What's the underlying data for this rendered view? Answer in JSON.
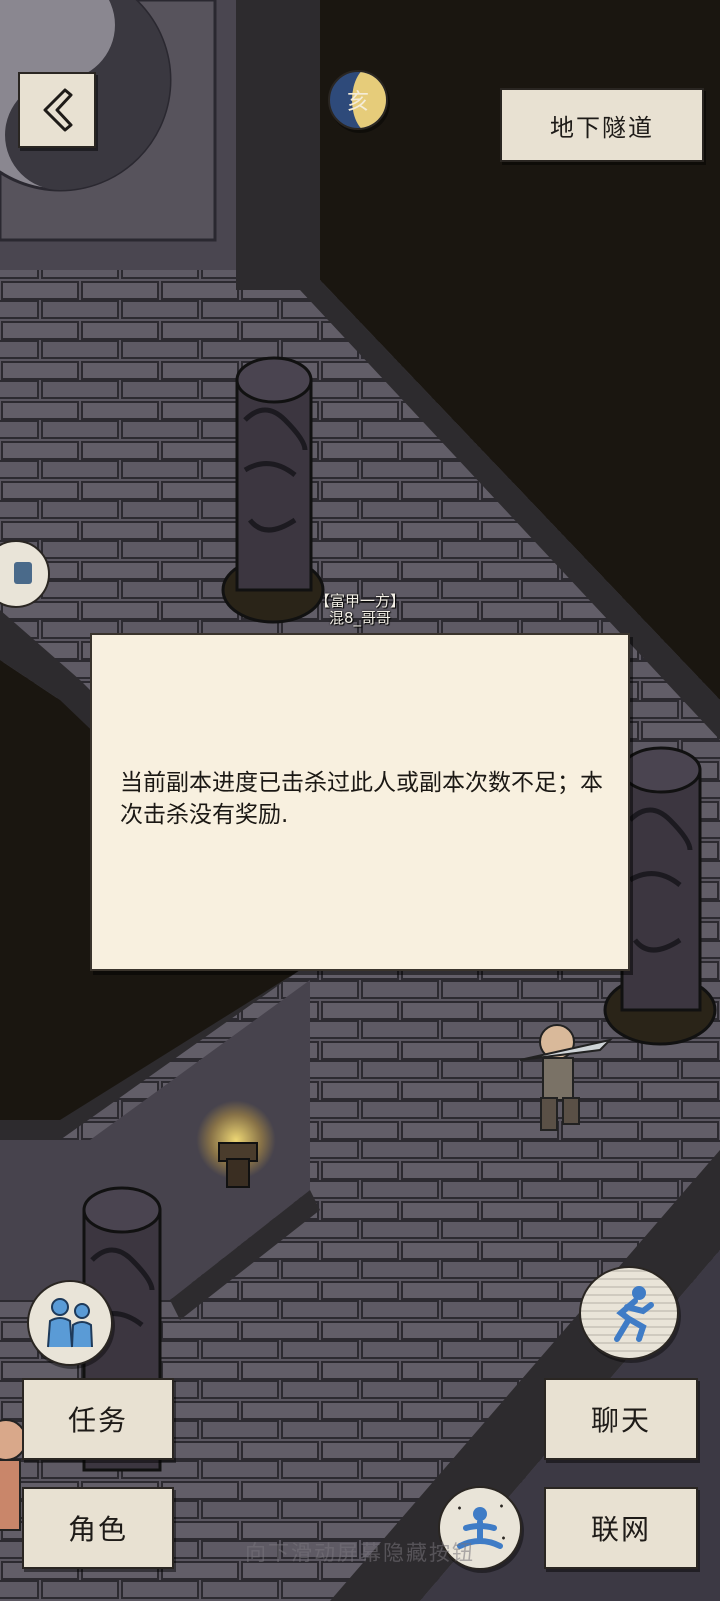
{
  "location_label": "地下隧道",
  "npc": {
    "title": "【富甲一方】",
    "name": "混8_哥哥"
  },
  "dialog": {
    "message": "当前副本进度已击杀过此人或副本次数不足；本次击杀没有奖励."
  },
  "buttons": {
    "quest": "任务",
    "character": "角色",
    "chat": "聊天",
    "network": "联网"
  },
  "zodiac_badge": {
    "glyph": "亥",
    "icon": "moon-zodiac-icon"
  },
  "hint_text": "向下滑动屏幕隐藏按钮",
  "icons": [
    "back-arrow-icon",
    "team-icon",
    "run-icon",
    "meditate-icon",
    "torch-icon",
    "side-tab-icon"
  ]
}
